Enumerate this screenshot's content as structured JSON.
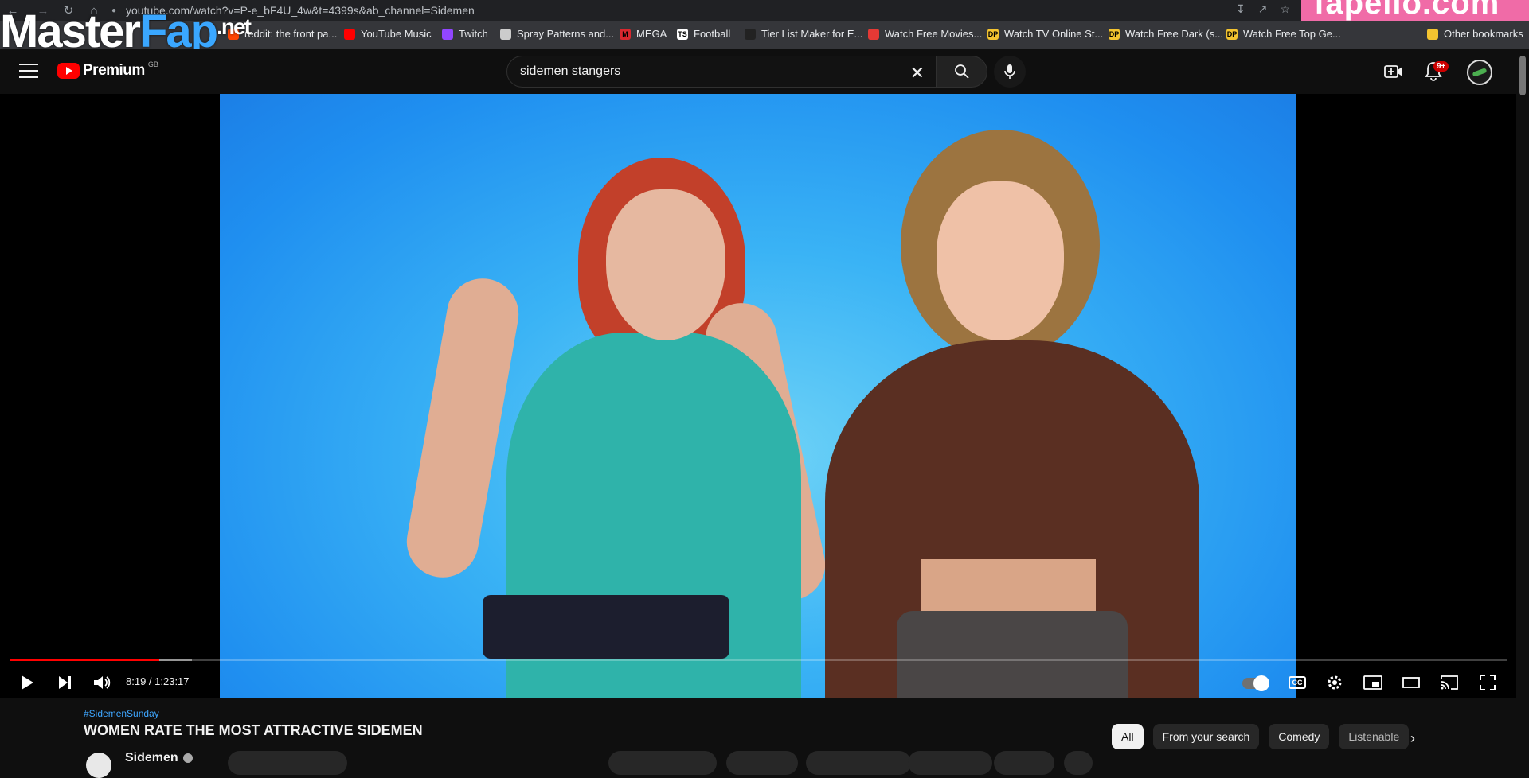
{
  "browser": {
    "url": "youtube.com/watch?v=P-e_bF4U_4w&t=4399s&ab_channel=Sidemen",
    "banner_text": "fapello.com"
  },
  "bookmarks": [
    {
      "label": "reddit: the front pa...",
      "color": "#ff4500",
      "glyph": ""
    },
    {
      "label": "YouTube Music",
      "color": "#ff0000",
      "glyph": ""
    },
    {
      "label": "Twitch",
      "color": "#9146ff",
      "glyph": ""
    },
    {
      "label": "Spray Patterns and...",
      "color": "#cccccc",
      "glyph": ""
    },
    {
      "label": "MEGA",
      "color": "#d9272e",
      "glyph": "M"
    },
    {
      "label": "Football",
      "color": "#ffffff",
      "glyph": "TS"
    },
    {
      "label": "Tier List Maker for E...",
      "color": "#222222",
      "glyph": ""
    },
    {
      "label": "Watch Free Movies...",
      "color": "#e53935",
      "glyph": ""
    },
    {
      "label": "Watch TV Online St...",
      "color": "#f4c430",
      "glyph": "DP"
    },
    {
      "label": "Watch Free Dark (s...",
      "color": "#f4c430",
      "glyph": "DP"
    },
    {
      "label": "Watch Free Top Ge...",
      "color": "#f4c430",
      "glyph": "DP"
    }
  ],
  "other_bookmarks": "Other bookmarks",
  "watermark": {
    "part1": "Master",
    "part2": "Fap",
    "part3": ".net"
  },
  "header": {
    "logo_word": "Premium",
    "region": "GB",
    "search_value": "sidemen stangers",
    "notification_count": "9+"
  },
  "player": {
    "current_time": "8:19",
    "duration": "1:23:17",
    "time_display": "8:19 / 1:23:17",
    "played_fraction": 0.0999,
    "cc_label": "CC"
  },
  "video": {
    "hashtag": "#SidemenSunday",
    "title": "WOMEN RATE THE MOST ATTRACTIVE SIDEMEN",
    "channel": "Sidemen"
  },
  "chips": [
    "All",
    "From your search",
    "Comedy",
    "Listenable"
  ],
  "colors": {
    "accent": "#ff0000",
    "link": "#3ea6ff",
    "bg": "#0f0f0f"
  }
}
